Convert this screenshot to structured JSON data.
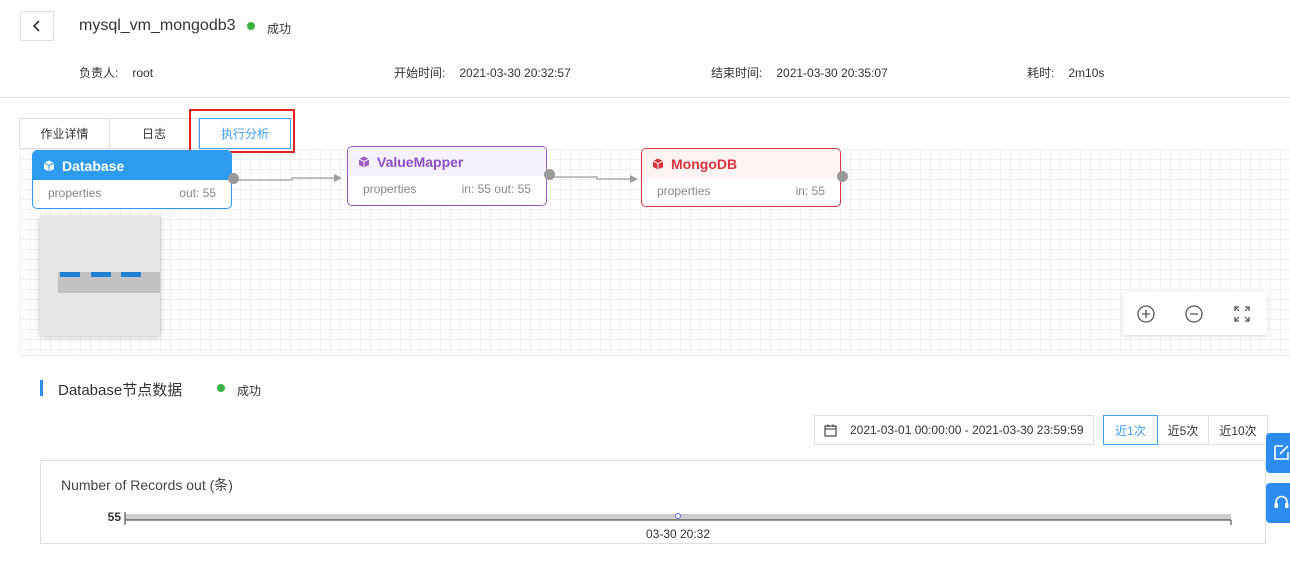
{
  "header": {
    "job_name": "mysql_vm_mongodb3",
    "status": "成功",
    "status_color": "#3bb346",
    "back_icon": "chevron-left-icon",
    "owner_label": "负责人:",
    "owner": "root",
    "start_label": "开始时间:",
    "start_time": "2021-03-30 20:32:57",
    "end_label": "结束时间:",
    "end_time": "2021-03-30 20:35:07",
    "duration_label": "耗时:",
    "duration": "2m10s"
  },
  "tabs": [
    {
      "label": "作业详情",
      "active": false
    },
    {
      "label": "日志",
      "active": false
    },
    {
      "label": "执行分析",
      "active": true
    }
  ],
  "nodes": [
    {
      "name": "Database",
      "props": "properties",
      "stats": "out: 55",
      "color": "#2d9cf0",
      "head_bg": "#2d9cf0",
      "head_text": "#ffffff"
    },
    {
      "name": "ValueMapper",
      "props": "properties",
      "stats": "in: 55 out: 55",
      "color": "#9b59c6",
      "head_bg": "#f6f2fb",
      "head_text": "#8e4ec6"
    },
    {
      "name": "MongoDB",
      "props": "properties",
      "stats": "in: 55",
      "color": "#d9343f",
      "head_bg": "#fff3f3",
      "head_text": "#d9343f"
    }
  ],
  "zoom_tools": [
    "zoom-in-icon",
    "zoom-out-icon",
    "fullscreen-icon"
  ],
  "section": {
    "title": "Database节点数据",
    "status": "成功"
  },
  "filter": {
    "calendar_icon": "calendar-icon",
    "date_range": "2021-03-01 00:00:00 - 2021-03-30 23:59:59",
    "recent": [
      {
        "label": "近1次",
        "active": true
      },
      {
        "label": "近5次",
        "active": false
      },
      {
        "label": "近10次",
        "active": false
      }
    ]
  },
  "side_buttons": [
    "edit-icon",
    "headset-icon"
  ],
  "chart": {
    "title": "Number of Records out (条)",
    "y_tick_label": "55",
    "x_tick_label": "03-30 20:32"
  },
  "chart_data": {
    "type": "line",
    "title": "Number of Records out (条)",
    "x": [
      "03-30 20:32"
    ],
    "series": [
      {
        "values": [
          55
        ]
      }
    ],
    "grid": false
  }
}
